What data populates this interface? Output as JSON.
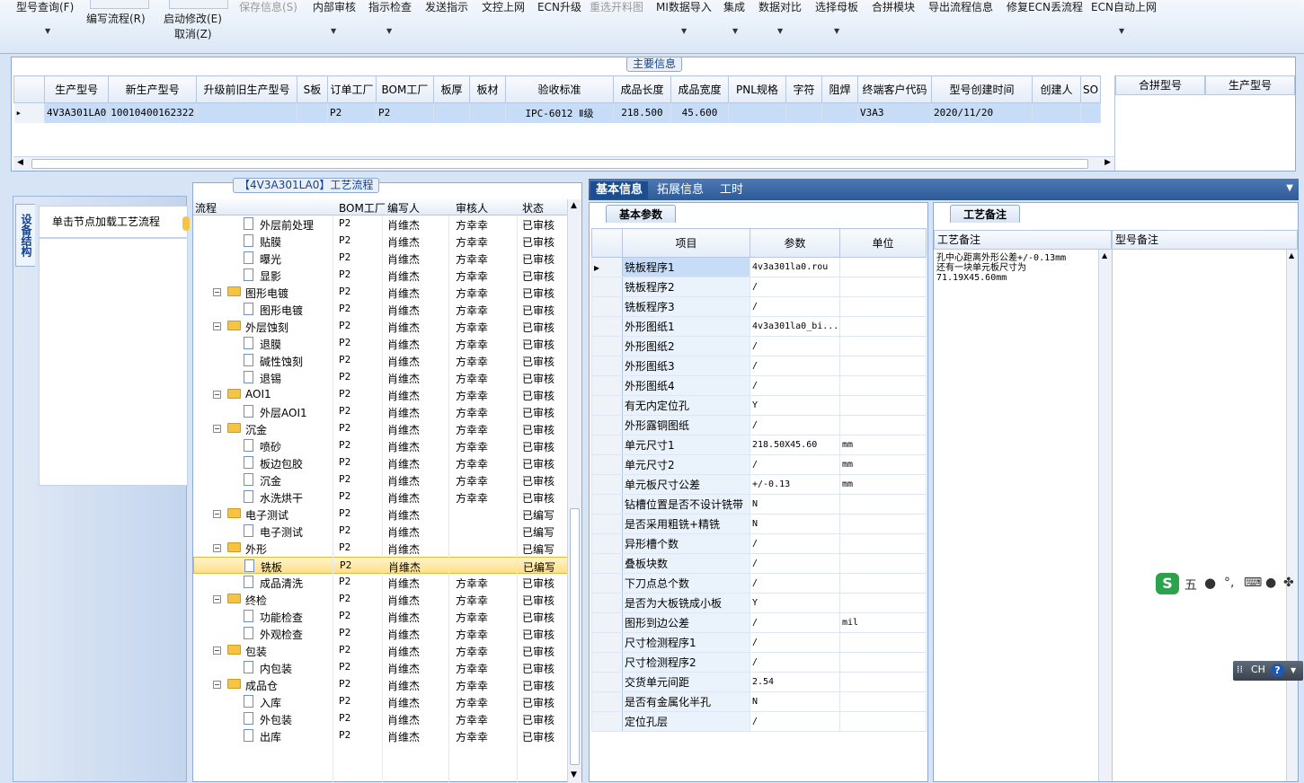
{
  "toolbar": {
    "model_query": "型号查询(F)",
    "write_flow": "编写流程(R)",
    "start_modify": "启动修改(E)",
    "cancel": "取消(Z)",
    "save_info": "保存信息(S)",
    "internal_review": "内部审核",
    "guide_check": "指示检查",
    "send_guide": "发送指示",
    "doc_upload": "文控上网",
    "ecn_upgrade": "ECN升级",
    "reselect_drawing": "重选开料图",
    "mi_import": "MI数据导入",
    "integrate": "集成",
    "data_compare": "数据对比",
    "select_mother": "选择母板",
    "merge_module": "合拼模块",
    "export_flow": "导出流程信息",
    "fix_ecn": "修复ECN丢流程",
    "ecn_auto": "ECN自动上网"
  },
  "main_info": {
    "caption": "主要信息",
    "columns": [
      "生产型号",
      "新生产型号",
      "升级前旧生产型号",
      "S板",
      "订单工厂",
      "BOM工厂",
      "板厚",
      "板材",
      "验收标准",
      "成品长度",
      "成品宽度",
      "PNL规格",
      "字符",
      "阻焊",
      "终端客户代码",
      "型号创建时间",
      "创建人",
      "SO"
    ],
    "row": [
      "4V3A301LA0",
      "10010400162322",
      "",
      "",
      "P2",
      "P2",
      "",
      "",
      "IPC-6012 Ⅱ级",
      "218.500",
      "45.600",
      "",
      "",
      "",
      "V3A3",
      "2020/11/20",
      "",
      ""
    ],
    "merge_columns": [
      "合拼型号",
      "生产型号"
    ]
  },
  "left_nav": {
    "tab": "设备结构",
    "item": "单击节点加载工艺流程"
  },
  "process": {
    "caption": "【4V3A301LA0】工艺流程",
    "columns": [
      "流程",
      "BOM工厂",
      "编写人",
      "审核人",
      "状态"
    ],
    "rows": [
      {
        "level": 2,
        "type": "doc",
        "name": "外层前处理",
        "bom": "P2",
        "writer": "肖维杰",
        "reviewer": "方幸幸",
        "status": "已审核"
      },
      {
        "level": 2,
        "type": "doc",
        "name": "贴膜",
        "bom": "P2",
        "writer": "肖维杰",
        "reviewer": "方幸幸",
        "status": "已审核"
      },
      {
        "level": 2,
        "type": "doc",
        "name": "曝光",
        "bom": "P2",
        "writer": "肖维杰",
        "reviewer": "方幸幸",
        "status": "已审核"
      },
      {
        "level": 2,
        "type": "doc",
        "name": "显影",
        "bom": "P2",
        "writer": "肖维杰",
        "reviewer": "方幸幸",
        "status": "已审核"
      },
      {
        "level": 1,
        "type": "folder",
        "name": "图形电镀",
        "bom": "P2",
        "writer": "肖维杰",
        "reviewer": "方幸幸",
        "status": "已审核"
      },
      {
        "level": 2,
        "type": "doc",
        "name": "图形电镀",
        "bom": "P2",
        "writer": "肖维杰",
        "reviewer": "方幸幸",
        "status": "已审核"
      },
      {
        "level": 1,
        "type": "folder",
        "name": "外层蚀刻",
        "bom": "P2",
        "writer": "肖维杰",
        "reviewer": "方幸幸",
        "status": "已审核"
      },
      {
        "level": 2,
        "type": "doc",
        "name": "退膜",
        "bom": "P2",
        "writer": "肖维杰",
        "reviewer": "方幸幸",
        "status": "已审核"
      },
      {
        "level": 2,
        "type": "doc",
        "name": "碱性蚀刻",
        "bom": "P2",
        "writer": "肖维杰",
        "reviewer": "方幸幸",
        "status": "已审核"
      },
      {
        "level": 2,
        "type": "doc",
        "name": "退锡",
        "bom": "P2",
        "writer": "肖维杰",
        "reviewer": "方幸幸",
        "status": "已审核"
      },
      {
        "level": 1,
        "type": "folder",
        "name": "AOI1",
        "bom": "P2",
        "writer": "肖维杰",
        "reviewer": "方幸幸",
        "status": "已审核"
      },
      {
        "level": 2,
        "type": "doc",
        "name": "外层AOI1",
        "bom": "P2",
        "writer": "肖维杰",
        "reviewer": "方幸幸",
        "status": "已审核"
      },
      {
        "level": 1,
        "type": "folder",
        "name": "沉金",
        "bom": "P2",
        "writer": "肖维杰",
        "reviewer": "方幸幸",
        "status": "已审核"
      },
      {
        "level": 2,
        "type": "doc",
        "name": "喷砂",
        "bom": "P2",
        "writer": "肖维杰",
        "reviewer": "方幸幸",
        "status": "已审核"
      },
      {
        "level": 2,
        "type": "doc",
        "name": "板边包胶",
        "bom": "P2",
        "writer": "肖维杰",
        "reviewer": "方幸幸",
        "status": "已审核"
      },
      {
        "level": 2,
        "type": "doc",
        "name": "沉金",
        "bom": "P2",
        "writer": "肖维杰",
        "reviewer": "方幸幸",
        "status": "已审核"
      },
      {
        "level": 2,
        "type": "doc",
        "name": "水洗烘干",
        "bom": "P2",
        "writer": "肖维杰",
        "reviewer": "方幸幸",
        "status": "已审核"
      },
      {
        "level": 1,
        "type": "folder",
        "name": "电子测试",
        "bom": "P2",
        "writer": "肖维杰",
        "reviewer": "",
        "status": "已编写"
      },
      {
        "level": 2,
        "type": "doc",
        "name": "电子测试",
        "bom": "P2",
        "writer": "肖维杰",
        "reviewer": "",
        "status": "已编写"
      },
      {
        "level": 1,
        "type": "folder",
        "name": "外形",
        "bom": "P2",
        "writer": "肖维杰",
        "reviewer": "",
        "status": "已编写"
      },
      {
        "level": 2,
        "type": "doc",
        "name": "铣板",
        "bom": "P2",
        "writer": "肖维杰",
        "reviewer": "",
        "status": "已编写",
        "selected": true
      },
      {
        "level": 2,
        "type": "doc",
        "name": "成品清洗",
        "bom": "P2",
        "writer": "肖维杰",
        "reviewer": "方幸幸",
        "status": "已审核"
      },
      {
        "level": 1,
        "type": "folder",
        "name": "终检",
        "bom": "P2",
        "writer": "肖维杰",
        "reviewer": "方幸幸",
        "status": "已审核"
      },
      {
        "level": 2,
        "type": "doc",
        "name": "功能检查",
        "bom": "P2",
        "writer": "肖维杰",
        "reviewer": "方幸幸",
        "status": "已审核"
      },
      {
        "level": 2,
        "type": "doc",
        "name": "外观检查",
        "bom": "P2",
        "writer": "肖维杰",
        "reviewer": "方幸幸",
        "status": "已审核"
      },
      {
        "level": 1,
        "type": "folder",
        "name": "包装",
        "bom": "P2",
        "writer": "肖维杰",
        "reviewer": "方幸幸",
        "status": "已审核"
      },
      {
        "level": 2,
        "type": "doc",
        "name": "内包装",
        "bom": "P2",
        "writer": "肖维杰",
        "reviewer": "方幸幸",
        "status": "已审核"
      },
      {
        "level": 1,
        "type": "folder",
        "name": "成品仓",
        "bom": "P2",
        "writer": "肖维杰",
        "reviewer": "方幸幸",
        "status": "已审核"
      },
      {
        "level": 2,
        "type": "doc",
        "name": "入库",
        "bom": "P2",
        "writer": "肖维杰",
        "reviewer": "方幸幸",
        "status": "已审核"
      },
      {
        "level": 2,
        "type": "doc",
        "name": "外包装",
        "bom": "P2",
        "writer": "肖维杰",
        "reviewer": "方幸幸",
        "status": "已审核"
      },
      {
        "level": 2,
        "type": "doc",
        "name": "出库",
        "bom": "P2",
        "writer": "肖维杰",
        "reviewer": "方幸幸",
        "status": "已审核"
      }
    ]
  },
  "right_tabs": [
    "基本信息",
    "拓展信息",
    "工时"
  ],
  "basic_params": {
    "tab": "基本参数",
    "columns": [
      "项目",
      "参数",
      "单位"
    ],
    "rows": [
      [
        "铣板程序1",
        "4v3a301la0.rou",
        ""
      ],
      [
        "铣板程序2",
        "/",
        ""
      ],
      [
        "铣板程序3",
        "/",
        ""
      ],
      [
        "外形图纸1",
        "4v3a301la0_bi...",
        ""
      ],
      [
        "外形图纸2",
        "/",
        ""
      ],
      [
        "外形图纸3",
        "/",
        ""
      ],
      [
        "外形图纸4",
        "/",
        ""
      ],
      [
        "有无内定位孔",
        "Y",
        ""
      ],
      [
        "外形露铜图纸",
        "/",
        ""
      ],
      [
        "单元尺寸1",
        "218.50X45.60",
        "mm"
      ],
      [
        "单元尺寸2",
        "/",
        "mm"
      ],
      [
        "单元板尺寸公差",
        "+/-0.13",
        "mm"
      ],
      [
        "钻槽位置是否不设计铣带",
        "N",
        ""
      ],
      [
        "是否采用粗铣+精铣",
        "N",
        ""
      ],
      [
        "异形槽个数",
        "/",
        ""
      ],
      [
        "叠板块数",
        "/",
        ""
      ],
      [
        "下刀点总个数",
        "/",
        ""
      ],
      [
        "是否为大板铣成小板",
        "Y",
        ""
      ],
      [
        "图形到边公差",
        "/",
        "mil"
      ],
      [
        "尺寸检测程序1",
        "/",
        ""
      ],
      [
        "尺寸检测程序2",
        "/",
        ""
      ],
      [
        "交货单元间距",
        "2.54",
        ""
      ],
      [
        "是否有金属化半孔",
        "N",
        ""
      ],
      [
        "定位孔层",
        "/",
        ""
      ]
    ]
  },
  "notes": {
    "tab": "工艺备注",
    "process_note_header": "工艺备注",
    "model_note_header": "型号备注",
    "process_note_text": [
      "孔中心距离外形公差+/-0.13mm",
      "还有一块单元板尺寸为",
      "71.19X45.60mm"
    ]
  },
  "ime": {
    "mode": "五",
    "lang": "CH",
    "help": "?"
  }
}
